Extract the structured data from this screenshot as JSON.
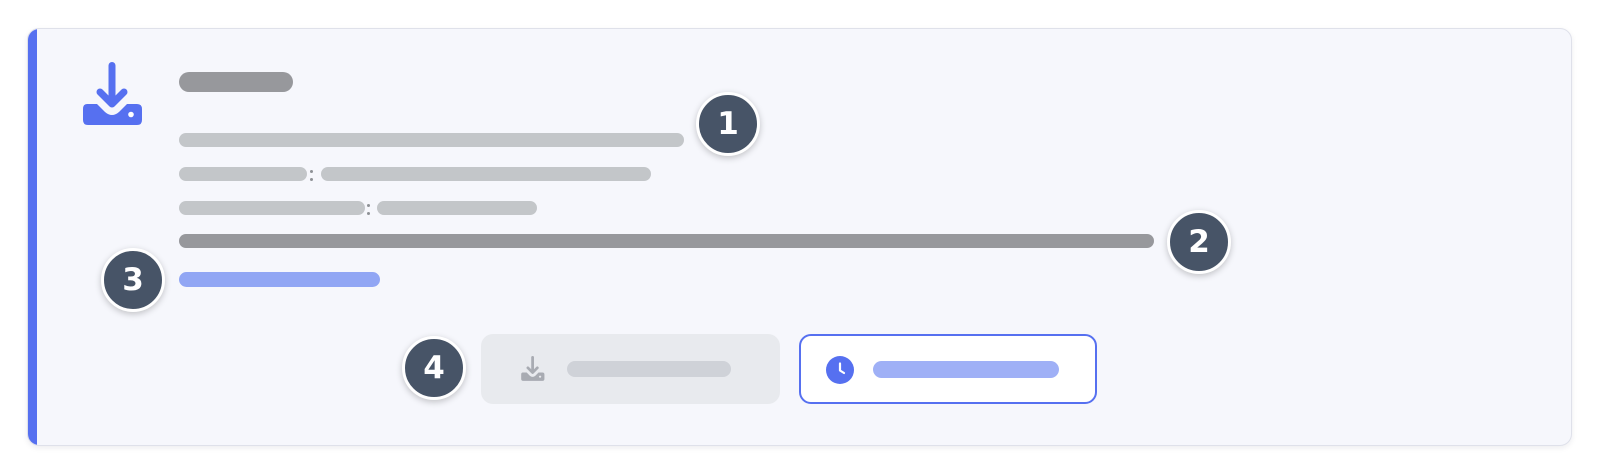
{
  "badges": [
    "1",
    "2",
    "3",
    "4"
  ],
  "icons": {
    "main": "download-tray-icon",
    "secondary_button": "download-tray-icon",
    "outline_button": "clock-icon"
  },
  "colors": {
    "accent": "#5670f0",
    "badge": "#475467",
    "text_placeholder_dark": "#97989c",
    "text_placeholder_light": "#c3c6c9",
    "link_placeholder": "#91a6f4"
  }
}
